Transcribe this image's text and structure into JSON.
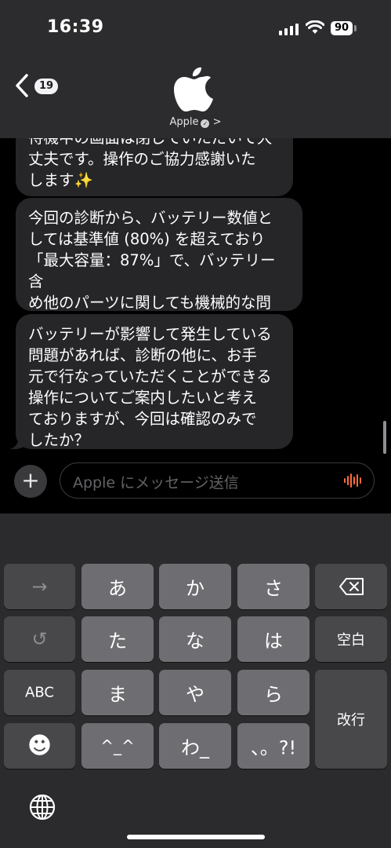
{
  "status": {
    "time": "16:39",
    "battery": "90"
  },
  "header": {
    "back_count": "19",
    "contact": "Apple",
    "chevron": ">"
  },
  "messages": [
    "待機中の画面は閉じていただいて大\n丈夫です。操作のご協力感謝いた\nします✨",
    "今回の診断から、バッテリー数値と\nしては基準値 (80%) を超えており\n「最大容量：87%」で、バッテリー含\nめ他のパーツに関しても機械的な問\n題は検出されませんでした。",
    "バッテリーが影響して発生している\n問題があれば、診断の他に、お手\n元で行なっていただくことができる\n操作についてご案内したいと考え\nておりますが、今回は確認のみで\nしたか？"
  ],
  "composer": {
    "placeholder": "Apple にメッセージ送信",
    "plus": "+"
  },
  "keyboard": {
    "arrow": "→",
    "undo": "↺",
    "abc": "ABC",
    "emoji": "☻",
    "a": "あ",
    "ka": "か",
    "sa": "さ",
    "ta": "た",
    "na": "な",
    "ha": "は",
    "ma": "ま",
    "ya": "や",
    "ra": "ら",
    "kao": "^_^",
    "wa": "わ_",
    "punct": "、。?!",
    "delete": "⌫",
    "space": "空白",
    "enter": "改行"
  },
  "colors": {
    "bubble": "#262629",
    "header": "#2c2c2e",
    "mic": "#ff6b3d"
  }
}
